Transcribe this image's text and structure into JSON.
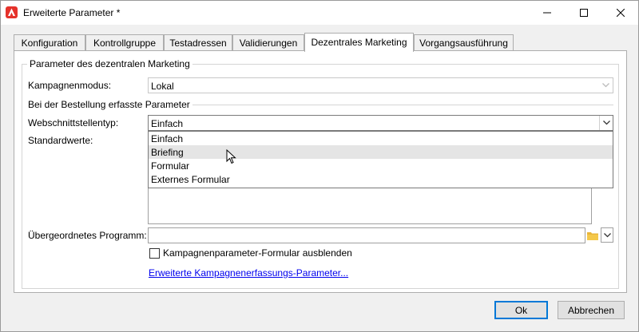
{
  "window": {
    "title": "Erweiterte Parameter *"
  },
  "tabs": [
    {
      "label": "Konfiguration"
    },
    {
      "label": "Kontrollgruppe"
    },
    {
      "label": "Testadressen"
    },
    {
      "label": "Validierungen"
    },
    {
      "label": "Dezentrales Marketing",
      "active": true
    },
    {
      "label": "Vorgangsausführung"
    }
  ],
  "panel": {
    "group_title": "Parameter des dezentralen Marketing",
    "kampagnenmodus_label": "Kampagnenmodus:",
    "kampagnenmodus_value": "Lokal",
    "bestellung_section": "Bei der Bestellung erfasste Parameter",
    "webschnittstellentyp_label": "Webschnittstellentyp:",
    "webschnittstellentyp_value": "Einfach",
    "dropdown_options": [
      "Einfach",
      "Briefing",
      "Formular",
      "Externes Formular"
    ],
    "dropdown_hover_index": 1,
    "standardwerte_label": "Standardwerte:",
    "programm_label": "Übergeordnetes Programm:",
    "programm_value": "",
    "hide_form_label": "Kampagnenparameter-Formular ausblenden",
    "hide_form_checked": false,
    "advanced_link": "Erweiterte Kampagnenerfassungs-Parameter..."
  },
  "buttons": {
    "ok": "Ok",
    "cancel": "Abbrechen"
  },
  "colors": {
    "accent": "#0078d7",
    "app_icon": "#e5322b",
    "link": "#0000ee",
    "folder": "#e8b53a"
  }
}
